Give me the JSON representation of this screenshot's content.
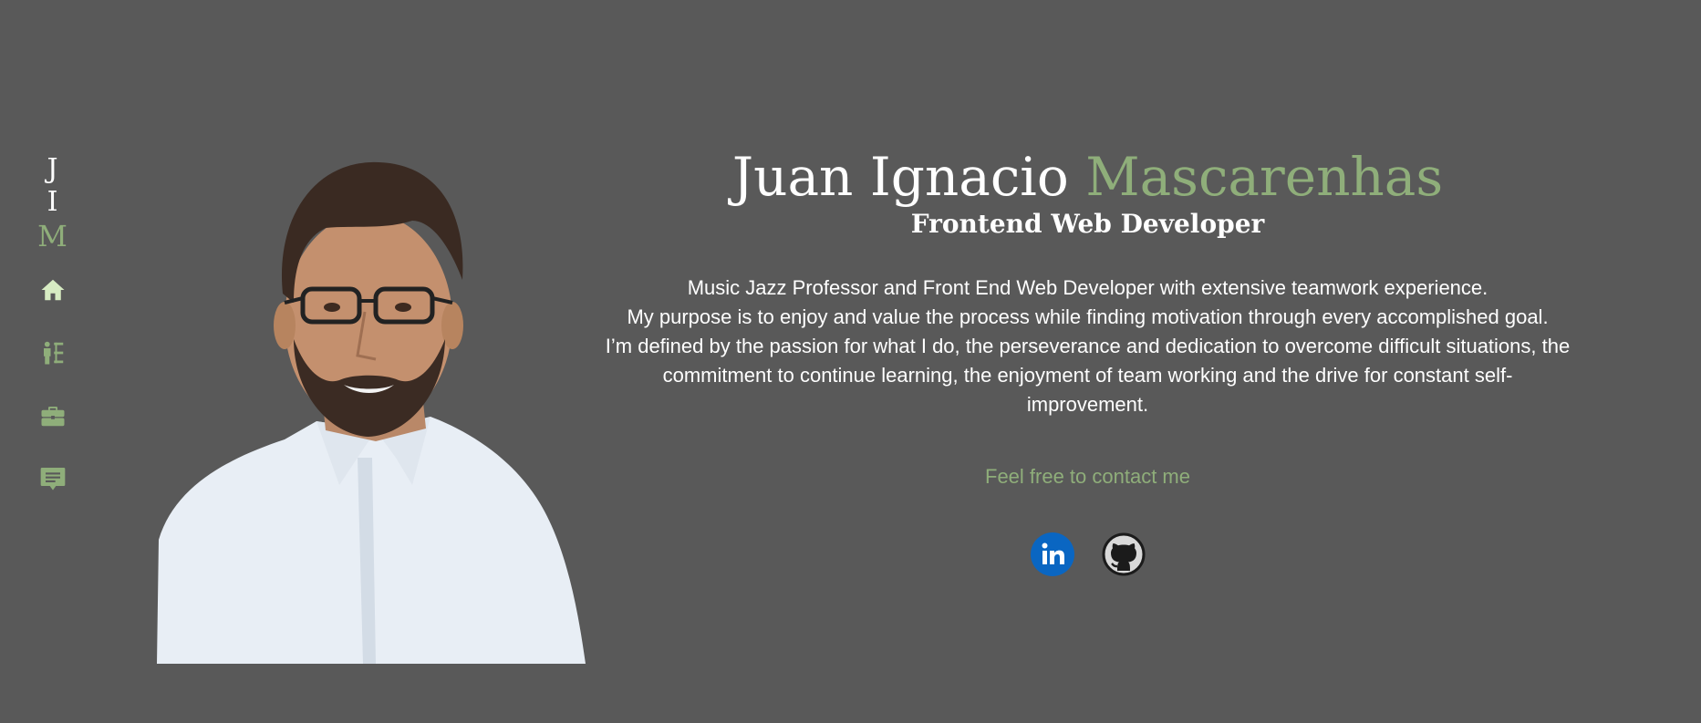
{
  "logo": {
    "line1": "J I",
    "line2": "M"
  },
  "nav": [
    {
      "icon": "home-icon",
      "name": "nav-home"
    },
    {
      "icon": "skills-icon",
      "name": "nav-skills"
    },
    {
      "icon": "briefcase-icon",
      "name": "nav-projects"
    },
    {
      "icon": "message-icon",
      "name": "nav-contact"
    }
  ],
  "hero": {
    "first_name": "Juan Ignacio ",
    "last_name": "Mascarenhas",
    "role": "Frontend Web Developer",
    "bio": [
      "Music Jazz Professor and Front End Web Developer with extensive teamwork experience.",
      "My purpose is to enjoy and value the process while finding motivation through every accomplished goal.",
      "I’m defined by the passion for what I do, the perseverance and dedication to overcome difficult situations, the commitment to continue learning, the enjoyment of team working and the drive for constant self-improvement."
    ],
    "contact_label": "Feel free to contact me"
  },
  "social": [
    {
      "icon": "linkedin-icon"
    },
    {
      "icon": "github-icon"
    }
  ],
  "colors": {
    "background": "#595959",
    "accent": "#8fae7a",
    "text": "#ffffff",
    "linkedin": "#0a66c2"
  }
}
